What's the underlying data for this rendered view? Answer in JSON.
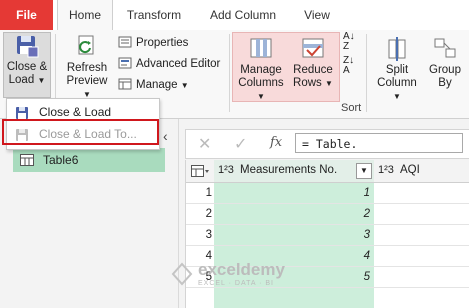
{
  "tabs": [
    "File",
    "Home",
    "Transform",
    "Add Column",
    "View"
  ],
  "ribbon": {
    "close_load": {
      "line1": "Close &",
      "line2": "Load"
    },
    "refresh_preview": {
      "line1": "Refresh",
      "line2": "Preview"
    },
    "properties": "Properties",
    "advanced_editor": "Advanced Editor",
    "manage": "Manage",
    "manage_columns": {
      "line1": "Manage",
      "line2": "Columns"
    },
    "reduce_rows": {
      "line1": "Reduce",
      "line2": "Rows"
    },
    "sort_label": "Sort",
    "split_column": {
      "line1": "Split",
      "line2": "Column"
    },
    "group_by": {
      "line1": "Group",
      "line2": "By"
    }
  },
  "dropdown": {
    "items": [
      "Close & Load",
      "Close & Load To..."
    ]
  },
  "queries": [
    {
      "name": "Table6"
    }
  ],
  "formula": {
    "fx": "fx",
    "text": "= Table."
  },
  "grid": {
    "columns": [
      {
        "type_icon": "1²3",
        "name": "Measurements No."
      },
      {
        "type_icon": "1²3",
        "name": "AQI"
      }
    ],
    "rows": [
      {
        "n": "1",
        "v": "1"
      },
      {
        "n": "2",
        "v": "2"
      },
      {
        "n": "3",
        "v": "3"
      },
      {
        "n": "4",
        "v": "4"
      },
      {
        "n": "5",
        "v": "5"
      }
    ]
  },
  "watermark": {
    "brand": "exceldemy",
    "tagline": "EXCEL · DATA · BI"
  },
  "colors": {
    "file_tab": "#e53935",
    "highlight_box": "#d0171d",
    "selected_query": "#a9dbbe",
    "column_fill": "#cdeedb"
  }
}
